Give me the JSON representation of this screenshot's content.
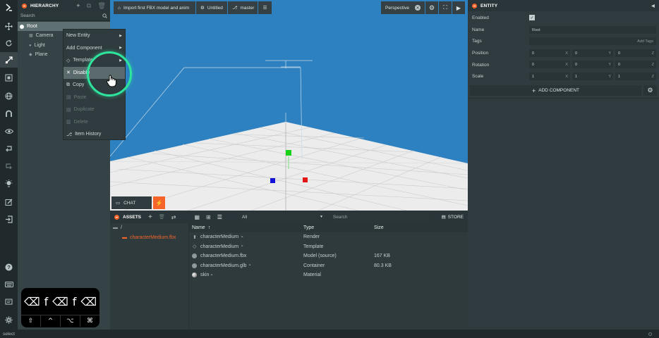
{
  "hierarchy": {
    "title": "HIERARCHY",
    "search_placeholder": "Search",
    "root_label": "Root",
    "children": [
      {
        "label": "Camera",
        "icon": "camera-icon"
      },
      {
        "label": "Light",
        "icon": "light-icon"
      },
      {
        "label": "Plane",
        "icon": "plane-icon"
      }
    ]
  },
  "context_menu": {
    "items": [
      {
        "label": "New Entity",
        "submenu": true
      },
      {
        "label": "Add Component",
        "submenu": true
      },
      {
        "label": "Template",
        "submenu": true
      },
      {
        "label": "Disable",
        "highlighted": true
      },
      {
        "label": "Copy"
      },
      {
        "label": "Paste",
        "disabled": true
      },
      {
        "label": "Duplicate",
        "disabled": true
      },
      {
        "label": "Delete",
        "disabled": true
      },
      {
        "label": "Item History"
      }
    ]
  },
  "viewport": {
    "tab_label": "Import first FBX model and anim",
    "scene_label": "Untitled",
    "branch_label": "master",
    "camera_label": "Perspective",
    "chat_label": "CHAT"
  },
  "assets": {
    "title": "ASSETS",
    "filter_value": "All",
    "search_placeholder": "Search",
    "store_label": "STORE",
    "folder_root": "/",
    "folders": [
      "characterMedium.fbx"
    ],
    "columns": {
      "name": "Name",
      "type": "Type",
      "size": "Size"
    },
    "rows": [
      {
        "name": "characterMedium",
        "type": "Render",
        "size": "",
        "icon": "render-icon"
      },
      {
        "name": "characterMedium",
        "type": "Template",
        "size": "",
        "icon": "template-icon"
      },
      {
        "name": "characterMedium.fbx",
        "type": "Model (source)",
        "size": "167 KB",
        "icon": "model-icon"
      },
      {
        "name": "characterMedium.glb",
        "type": "Container",
        "size": "80.3 KB",
        "icon": "container-icon"
      },
      {
        "name": "skin",
        "type": "Material",
        "size": "",
        "icon": "material-icon"
      }
    ]
  },
  "inspector": {
    "title": "ENTITY",
    "enabled_label": "Enabled",
    "enabled": true,
    "name_label": "Name",
    "name_value": "Root",
    "tags_label": "Tags",
    "add_tags_label": "Add Tags",
    "position_label": "Position",
    "position": [
      "0",
      "0",
      "0"
    ],
    "rotation_label": "Rotation",
    "rotation": [
      "0",
      "0",
      "0"
    ],
    "scale_label": "Scale",
    "scale": [
      "1",
      "1",
      "1"
    ],
    "axes": [
      "X",
      "Y",
      "Z"
    ],
    "add_component_label": "ADD COMPONENT"
  },
  "keyboard_overlay": {
    "top_keys": [
      "⌫",
      "f",
      "⌫",
      "f",
      "⌫"
    ],
    "bottom_keys": [
      "⇧",
      "^",
      "⌥",
      "⌘"
    ]
  },
  "status": {
    "text": "select"
  },
  "colors": {
    "accent": "#f5652a",
    "viewport_sky": "#2d81c0",
    "cursor_ring": "#2ee59d"
  }
}
